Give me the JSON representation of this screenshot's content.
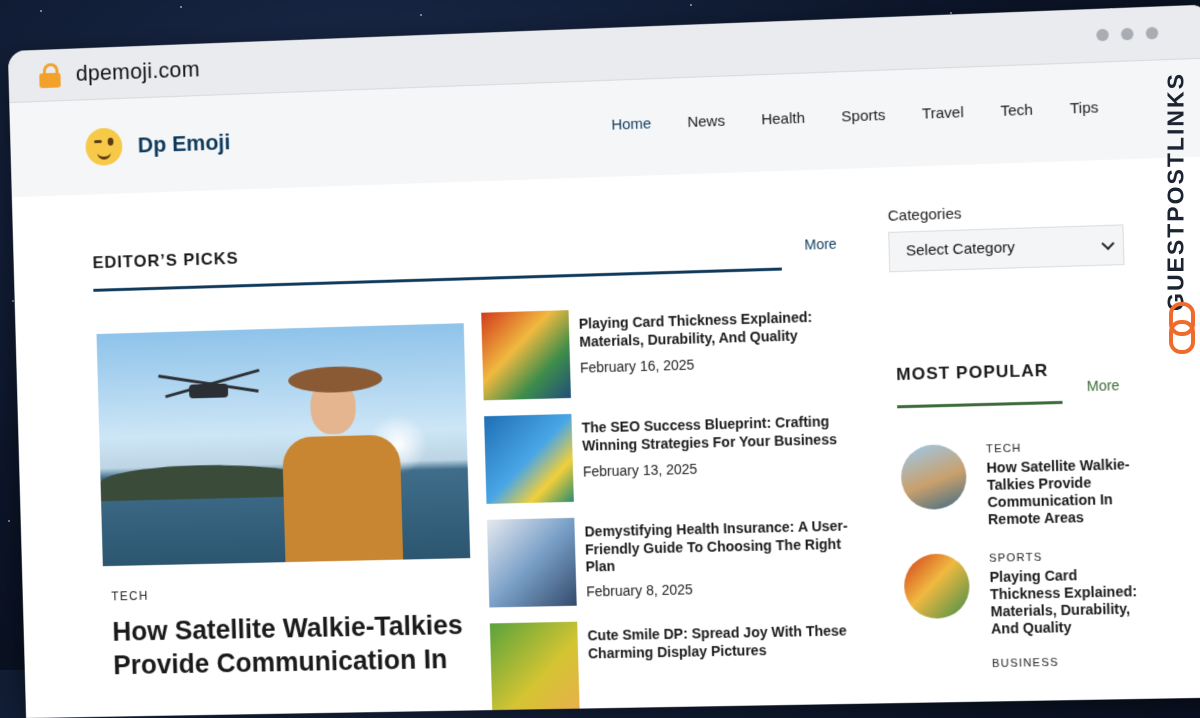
{
  "browser": {
    "url": "dpemoji.com"
  },
  "site": {
    "brand": "Dp Emoji",
    "nav": [
      "Home",
      "News",
      "Health",
      "Sports",
      "Travel",
      "Tech",
      "Tips"
    ]
  },
  "editors_picks": {
    "title": "EDITOR’S PICKS",
    "more": "More",
    "featured": {
      "category": "TECH",
      "title": "How Satellite Walkie-Talkies Provide Communication In"
    },
    "posts": [
      {
        "title": "Playing Card Thickness Explained: Materials, Durability, And Quality",
        "date": "February 16, 2025"
      },
      {
        "title": "The SEO Success Blueprint: Crafting Winning Strategies For Your Business",
        "date": "February 13, 2025"
      },
      {
        "title": "Demystifying Health Insurance: A User-Friendly Guide To Choosing The Right Plan",
        "date": "February 8, 2025"
      },
      {
        "title": "Cute Smile DP: Spread Joy With These Charming Display Pictures",
        "date": ""
      }
    ]
  },
  "sidebar": {
    "categories_label": "Categories",
    "select_value": "Select Category",
    "most_popular": {
      "title": "MOST POPULAR",
      "more": "More",
      "items": [
        {
          "category": "TECH",
          "title": "How Satellite Walkie-Talkies Provide Communication In Remote Areas"
        },
        {
          "category": "SPORTS",
          "title": "Playing Card Thickness Explained: Materials, Durability, And Quality"
        },
        {
          "category": "BUSINESS",
          "title": ""
        }
      ]
    }
  },
  "watermark": {
    "text": "GUESTPOSTLINKS"
  },
  "colors": {
    "brand": "#0f3a5c",
    "popular_accent": "#3d6b3a",
    "lock": "#f2a12b",
    "watermark_icon": "#f06a2b"
  }
}
